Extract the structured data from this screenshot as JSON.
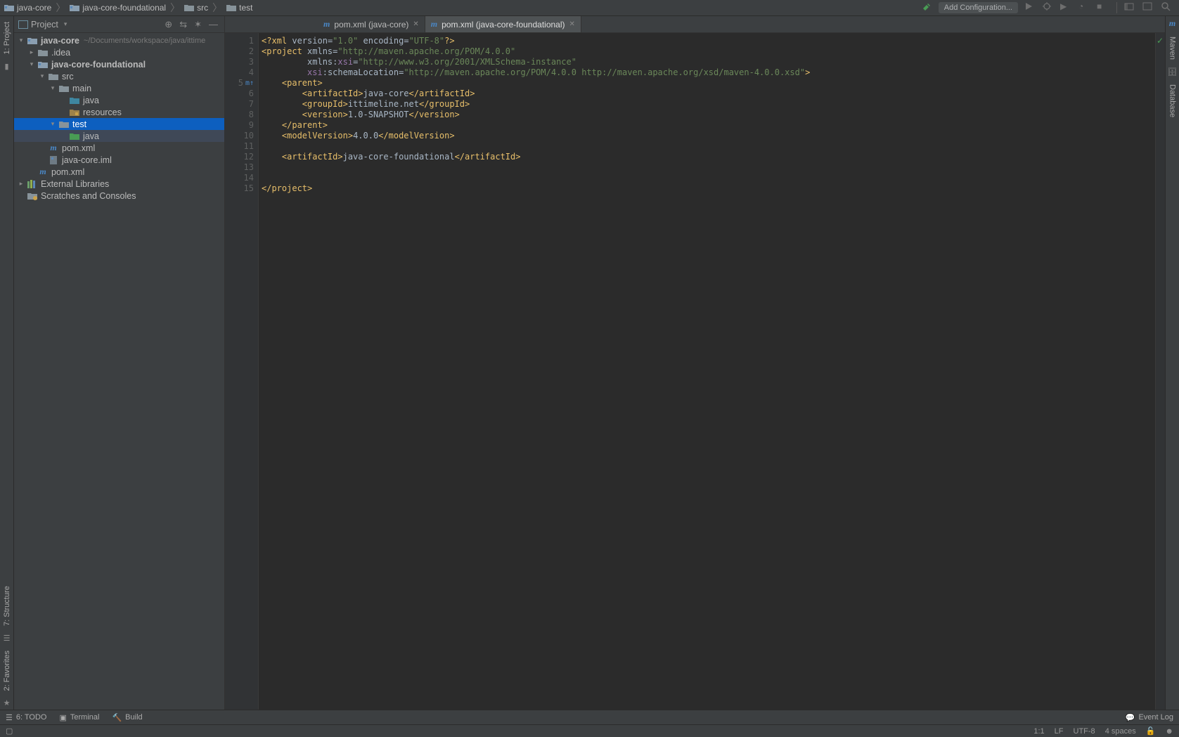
{
  "breadcrumb": [
    {
      "label": "java-core",
      "icon": "module"
    },
    {
      "label": "java-core-foundational",
      "icon": "module"
    },
    {
      "label": "src",
      "icon": "folder"
    },
    {
      "label": "test",
      "icon": "folder"
    }
  ],
  "toolbar": {
    "add_configuration": "Add Configuration..."
  },
  "left_stripe": {
    "project": "1: Project",
    "structure": "7: Structure",
    "favorites": "2: Favorites"
  },
  "right_stripe": {
    "maven": "Maven",
    "database": "Database"
  },
  "project_tool": {
    "title": "Project"
  },
  "tree": [
    {
      "depth": 0,
      "toggle": "▾",
      "icon": "module",
      "label": "java-core",
      "bold": true,
      "suffix": "~/Documents/workspace/java/ittime"
    },
    {
      "depth": 1,
      "toggle": "▸",
      "icon": "folder",
      "label": ".idea"
    },
    {
      "depth": 1,
      "toggle": "▾",
      "icon": "module",
      "label": "java-core-foundational",
      "bold": true
    },
    {
      "depth": 2,
      "toggle": "▾",
      "icon": "folder",
      "label": "src"
    },
    {
      "depth": 3,
      "toggle": "▾",
      "icon": "folder",
      "label": "main"
    },
    {
      "depth": 4,
      "toggle": "",
      "icon": "srcfolder",
      "label": "java"
    },
    {
      "depth": 4,
      "toggle": "",
      "icon": "resfolder",
      "label": "resources"
    },
    {
      "depth": 3,
      "toggle": "▾",
      "icon": "folder",
      "label": "test",
      "selected": true
    },
    {
      "depth": 4,
      "toggle": "",
      "icon": "testfolder",
      "label": "java",
      "highlighted": true
    },
    {
      "depth": 2,
      "toggle": "",
      "icon": "maven",
      "label": "pom.xml"
    },
    {
      "depth": 2,
      "toggle": "",
      "icon": "iml",
      "label": "java-core.iml"
    },
    {
      "depth": 1,
      "toggle": "",
      "icon": "maven",
      "label": "pom.xml"
    },
    {
      "depth": 0,
      "toggle": "▸",
      "icon": "lib",
      "label": "External Libraries"
    },
    {
      "depth": 0,
      "toggle": "",
      "icon": "scratch",
      "label": "Scratches and Consoles"
    }
  ],
  "tabs": [
    {
      "label": "pom.xml (java-core)",
      "active": false
    },
    {
      "label": "pom.xml (java-core-foundational)",
      "active": true
    }
  ],
  "code_lines": [
    {
      "n": 1,
      "html": "<span class='pi'>&lt;?xml</span> <span class='attr'>version</span>=<span class='str'>\"1.0\"</span> <span class='attr'>encoding</span>=<span class='str'>\"UTF-8\"</span><span class='pi'>?&gt;</span>"
    },
    {
      "n": 2,
      "html": "<span class='tag'>&lt;project</span> <span class='attr'>xmlns</span>=<span class='str'>\"http://maven.apache.org/POM/4.0.0\"</span>"
    },
    {
      "n": 3,
      "html": "         <span class='attr'>xmlns:</span><span class='attr' style='color:#9876aa'>xsi</span>=<span class='str'>\"http://www.w3.org/2001/XMLSchema-instance\"</span>"
    },
    {
      "n": 4,
      "html": "         <span class='attr' style='color:#9876aa'>xsi</span><span class='attr'>:schemaLocation</span>=<span class='str'>\"http://maven.apache.org/POM/4.0.0 http://maven.apache.org/xsd/maven-4.0.0.xsd\"</span><span class='tag'>&gt;</span>"
    },
    {
      "n": 5,
      "html": "    <span class='tag'>&lt;parent&gt;</span>",
      "mark": "m↑"
    },
    {
      "n": 6,
      "html": "        <span class='tag'>&lt;artifactId&gt;</span><span class='txt'>java-core</span><span class='tag'>&lt;/artifactId&gt;</span>"
    },
    {
      "n": 7,
      "html": "        <span class='tag'>&lt;groupId&gt;</span><span class='txt'>ittimeline.net</span><span class='tag'>&lt;/groupId&gt;</span>"
    },
    {
      "n": 8,
      "html": "        <span class='tag'>&lt;version&gt;</span><span class='txt'>1.0-SNAPSHOT</span><span class='tag'>&lt;/version&gt;</span>"
    },
    {
      "n": 9,
      "html": "    <span class='tag'>&lt;/parent&gt;</span>"
    },
    {
      "n": 10,
      "html": "    <span class='tag'>&lt;modelVersion&gt;</span><span class='txt'>4.0.0</span><span class='tag'>&lt;/modelVersion&gt;</span>"
    },
    {
      "n": 11,
      "html": ""
    },
    {
      "n": 12,
      "html": "    <span class='tag'>&lt;artifactId&gt;</span><span class='txt'>java-core-foundational</span><span class='tag'>&lt;/artifactId&gt;</span>"
    },
    {
      "n": 13,
      "html": ""
    },
    {
      "n": 14,
      "html": ""
    },
    {
      "n": 15,
      "html": "<span class='tag'>&lt;/project&gt;</span>"
    }
  ],
  "bottom": {
    "todo": "6: TODO",
    "terminal": "Terminal",
    "build": "Build",
    "event_log": "Event Log"
  },
  "status": {
    "pos": "1:1",
    "eol": "LF",
    "enc": "UTF-8",
    "indent": "4 spaces"
  }
}
